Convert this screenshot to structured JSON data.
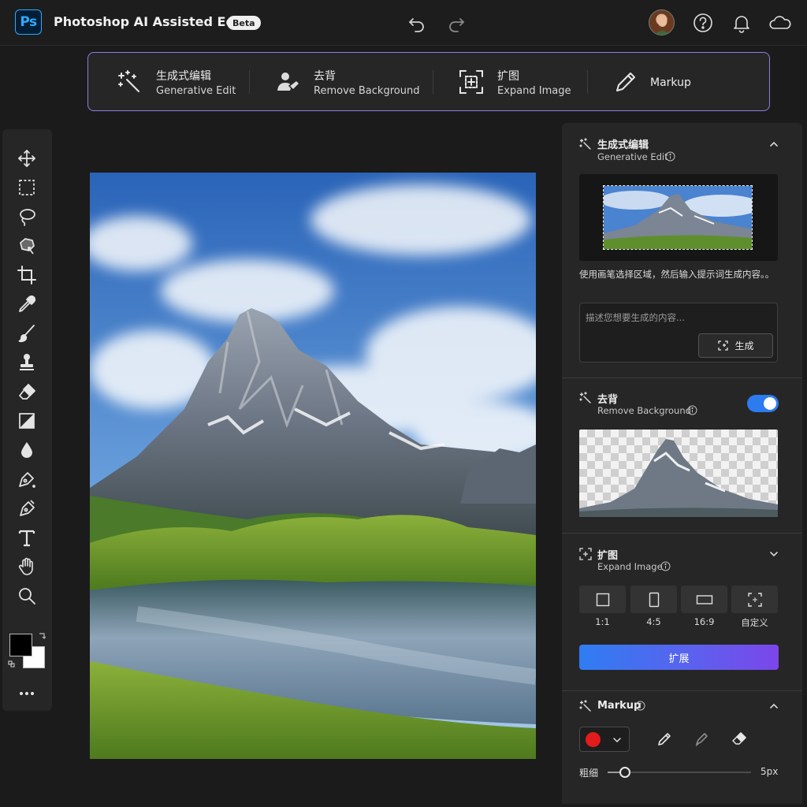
{
  "header": {
    "logo": "Ps",
    "title": "Photoshop AI Assisted Editor",
    "badge": "Beta",
    "icons": [
      "undo-icon",
      "redo-icon",
      "help-icon",
      "bell-icon",
      "cloud-icon"
    ]
  },
  "quickbar": {
    "items": [
      {
        "cn": "生成式编辑",
        "en": "Generative Edit",
        "icon": "magic-wand-icon"
      },
      {
        "cn": "去背",
        "en": "Remove Background",
        "icon": "remove-background-icon"
      },
      {
        "cn": "扩图",
        "en": "Expand Image",
        "icon": "expand-image-icon"
      },
      {
        "label": "Markup",
        "icon": "pencil-icon"
      }
    ]
  },
  "toolbar": {
    "tools": [
      "move-icon",
      "marquee-icon",
      "lasso-icon",
      "object-select-icon",
      "crop-icon",
      "eyedropper-icon",
      "brush-icon",
      "stamp-icon",
      "eraser-icon",
      "gradient-icon",
      "blur-drop-icon",
      "pen-icon",
      "freeform-pen-icon",
      "type-icon",
      "hand-icon",
      "zoom-icon"
    ],
    "foreground_color": "#000000",
    "background_color": "#ffffff",
    "more": "more-icon"
  },
  "panel": {
    "generative_edit": {
      "cn": "生成式编辑",
      "en": "Generative Edit",
      "hint": "使用画笔选择区域，然后输入提示词生成内容。。",
      "placeholder": "描述您想要生成的内容...",
      "button": "生成",
      "expanded": true
    },
    "remove_background": {
      "cn": "去背",
      "en": "Remove Background",
      "toggle_on": true
    },
    "expand_image": {
      "cn": "扩图",
      "en": "Expand Image",
      "ratios": [
        "1:1",
        "4:5",
        "16:9",
        "自定义"
      ],
      "button": "扩展"
    },
    "markup": {
      "title": "Markup",
      "color": "#e21b1b",
      "tools": [
        "pencil-icon",
        "marker-icon",
        "eraser-icon"
      ],
      "size_label": "粗细",
      "size_value": "5px",
      "size_fraction": 0.12
    }
  },
  "colors": {
    "accent": "#2c7bf0",
    "quickbar_border": "#8b7fe0",
    "gradient_start": "#2f7df2",
    "gradient_end": "#7c46ea"
  }
}
